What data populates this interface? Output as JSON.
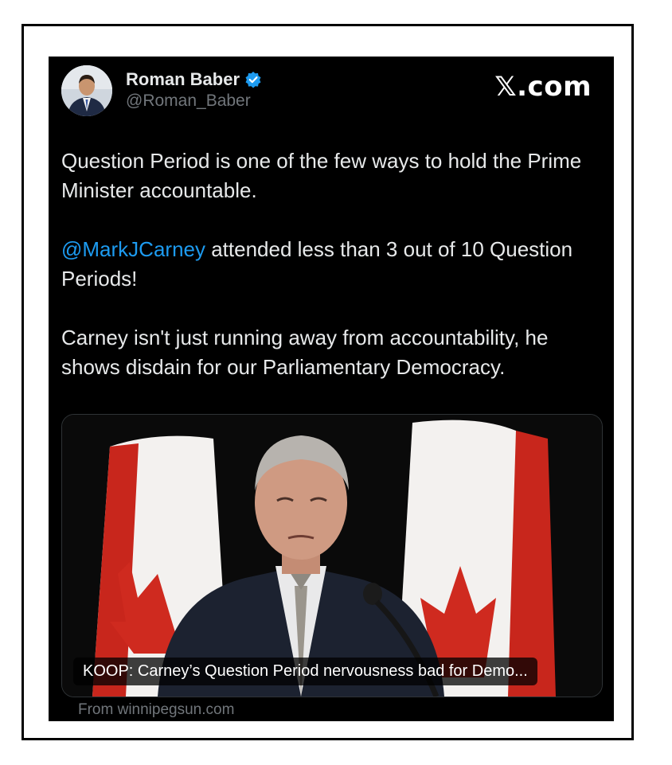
{
  "author": {
    "name": "Roman Baber",
    "handle": "@Roman_Baber",
    "verified": true,
    "verified_color": "#1d9bf0"
  },
  "brand": "𝕏.com",
  "tweet": {
    "paragraph1": "Question Period is one of the few ways to hold the Prime Minister accountable.",
    "mention": "@MarkJCarney",
    "paragraph2_rest": " attended less than 3 out of 10 Question Periods!",
    "paragraph3": "Carney isn't just running away from accountability, he shows disdain for our Parliamentary Democracy."
  },
  "card": {
    "caption": "KOOP: Carney’s Question Period nervousness bad for Demo...",
    "source": "From winnipegsun.com"
  },
  "colors": {
    "background": "#000000",
    "text": "#e7e9ea",
    "muted": "#71767b",
    "link": "#1d9bf0",
    "flag_red": "#d52b1e"
  }
}
